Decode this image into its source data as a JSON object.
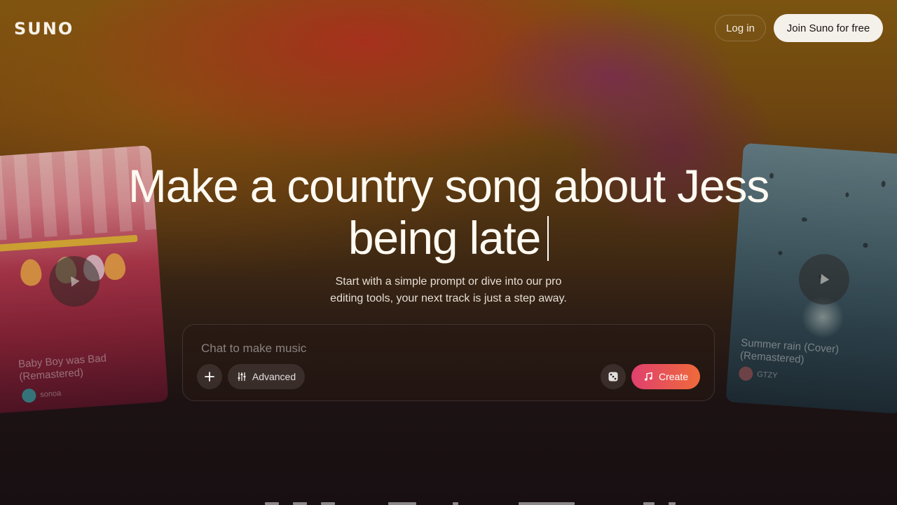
{
  "header": {
    "logo": "SUNO",
    "login_label": "Log in",
    "join_label": "Join Suno for free"
  },
  "hero": {
    "title_line1": "Make a country song about Jess",
    "title_line2": "being late",
    "subtitle_line1": "Start with a simple prompt or dive into our pro",
    "subtitle_line2": "editing tools, your next track is just a step away."
  },
  "prompt": {
    "placeholder": "Chat to make music",
    "advanced_label": "Advanced",
    "create_label": "Create"
  },
  "cards": {
    "left": {
      "title_line1": "Baby Boy was Bad",
      "title_line2": "(Remastered)",
      "artist": "sonoa"
    },
    "right": {
      "title_line1": "Summer rain (Cover)",
      "title_line2": "(Remastered)",
      "artist": "GTZY"
    }
  },
  "colors": {
    "accent_gradient_start": "#e0406e",
    "accent_gradient_end": "#ef6a3a",
    "join_button_bg": "#f4f0ea"
  },
  "icons": {
    "add": "plus-icon",
    "advanced": "sliders-icon",
    "random": "dice-icon",
    "create": "music-note-icon",
    "play": "play-icon"
  }
}
